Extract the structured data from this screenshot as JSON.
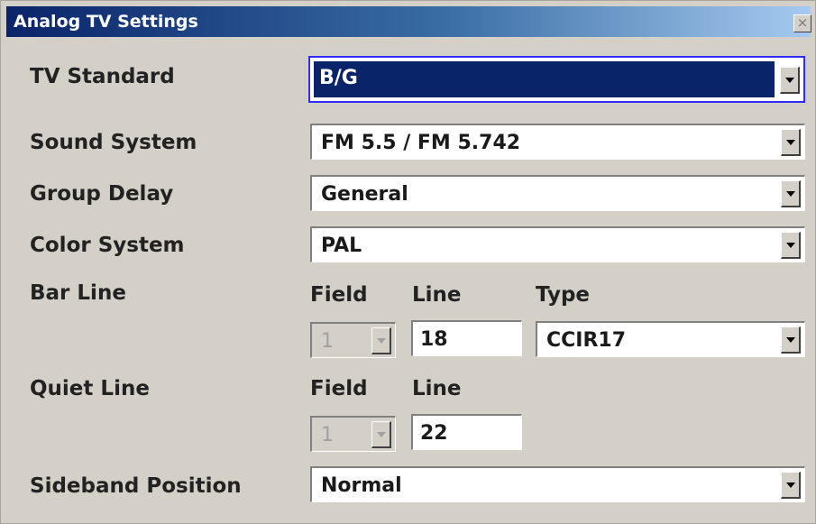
{
  "window": {
    "title": "Analog TV Settings",
    "close_glyph": "×"
  },
  "tv_standard": {
    "label": "TV Standard",
    "value": "B/G"
  },
  "sound_system": {
    "label": "Sound System",
    "value": "FM 5.5 / FM 5.742"
  },
  "group_delay": {
    "label": "Group Delay",
    "value": "General"
  },
  "color_system": {
    "label": "Color System",
    "value": "PAL"
  },
  "bar_line": {
    "label": "Bar Line",
    "field_header": "Field",
    "line_header": "Line",
    "type_header": "Type",
    "field_value": "1",
    "line_value": "18",
    "type_value": "CCIR17"
  },
  "quiet_line": {
    "label": "Quiet Line",
    "field_header": "Field",
    "line_header": "Line",
    "field_value": "1",
    "line_value": "22"
  },
  "sideband_position": {
    "label": "Sideband Position",
    "value": "Normal"
  }
}
